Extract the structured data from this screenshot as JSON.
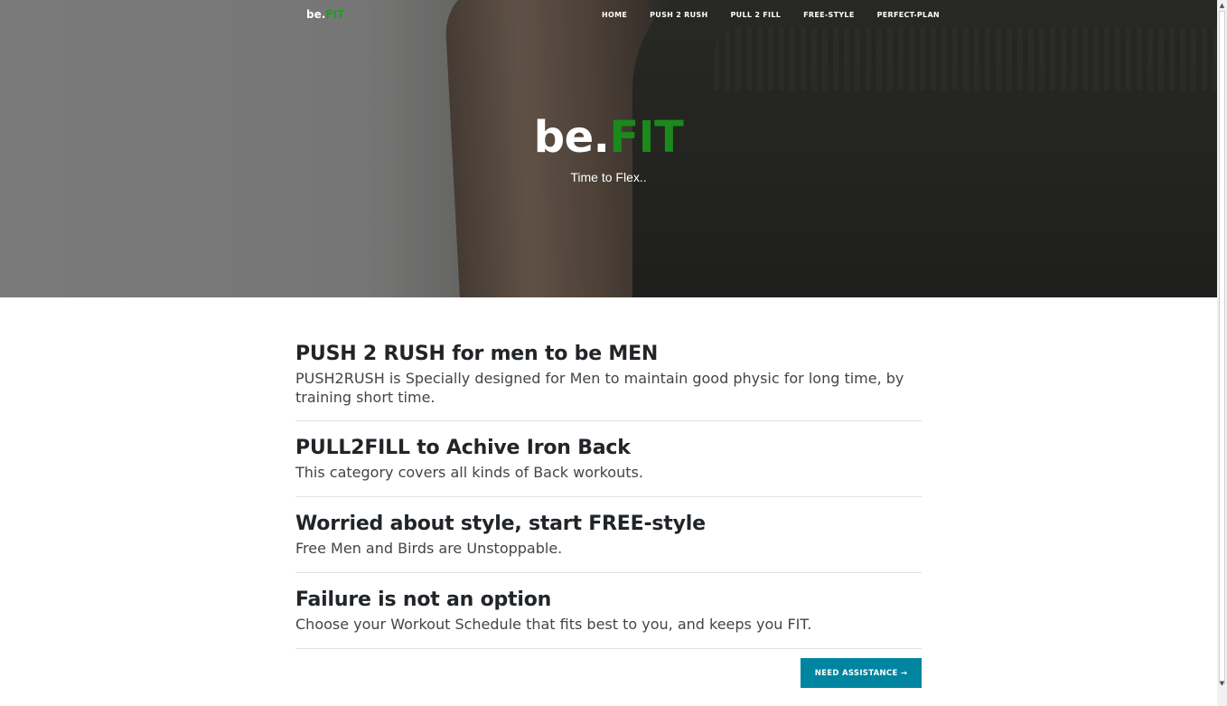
{
  "nav": {
    "brand_prefix": "be.",
    "brand_suffix": "FIT",
    "links": [
      "HOME",
      "PUSH 2 RUSH",
      "PULL 2 FILL",
      "FREE-STYLE",
      "PERFECT-PLAN"
    ]
  },
  "hero": {
    "title_prefix": "be.",
    "title_suffix": "FIT",
    "subtitle": "Time to Flex.."
  },
  "posts": [
    {
      "title": "PUSH 2 RUSH for men to be MEN",
      "text": "PUSH2RUSH is Specially designed for Men to maintain good physic for long time, by training short time."
    },
    {
      "title": "PULL2FILL to Achive Iron Back",
      "text": "This category covers all kinds of Back workouts."
    },
    {
      "title": "Worried about style, start FREE-style",
      "text": "Free Men and Birds are Unstoppable."
    },
    {
      "title": "Failure is not an option",
      "text": "Choose your Workout Schedule that fits best to you, and keeps you FIT."
    }
  ],
  "assist_button": "NEED ASSISTANCE →",
  "colors": {
    "accent_green": "#1a8a1a",
    "button_teal": "#0085a1"
  }
}
